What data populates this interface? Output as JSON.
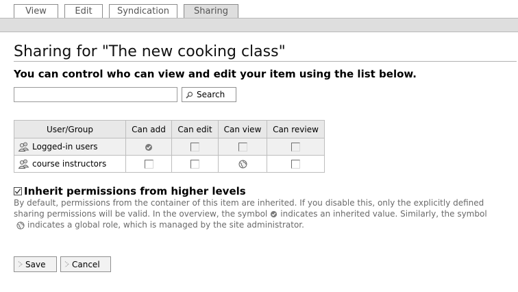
{
  "tabs": [
    {
      "label": "View"
    },
    {
      "label": "Edit"
    },
    {
      "label": "Syndication"
    },
    {
      "label": "Sharing",
      "active": true
    }
  ],
  "page": {
    "title": "Sharing for \"The new cooking class\"",
    "subtitle": "You can control who can view and edit your item using the list below."
  },
  "search": {
    "value": "",
    "placeholder": "",
    "button_label": "Search"
  },
  "table": {
    "headers": [
      "User/Group",
      "Can add",
      "Can edit",
      "Can view",
      "Can review"
    ],
    "rows": [
      {
        "name": "Logged-in users",
        "icon": "group-icon",
        "cells": [
          "inherited",
          "unchecked",
          "unchecked",
          "unchecked"
        ]
      },
      {
        "name": "course instructors",
        "icon": "group-icon",
        "cells": [
          "unchecked",
          "unchecked",
          "global",
          "unchecked"
        ]
      }
    ]
  },
  "inherit": {
    "checked": true,
    "label": "Inherit permissions from higher levels",
    "help_part1": "By default, permissions from the container of this item are inherited. If you disable this, only the explicitly defined sharing permissions will be valid. In the overview, the symbol",
    "help_part2": "indicates an inherited value. Similarly, the symbol",
    "help_part3": "indicates a global role, which is managed by the site administrator."
  },
  "actions": {
    "save_label": "Save",
    "cancel_label": "Cancel"
  },
  "colors": {
    "tab_bar": "#dedede",
    "header_bg": "#e8e8e8",
    "help_text": "#6a6a6a"
  }
}
